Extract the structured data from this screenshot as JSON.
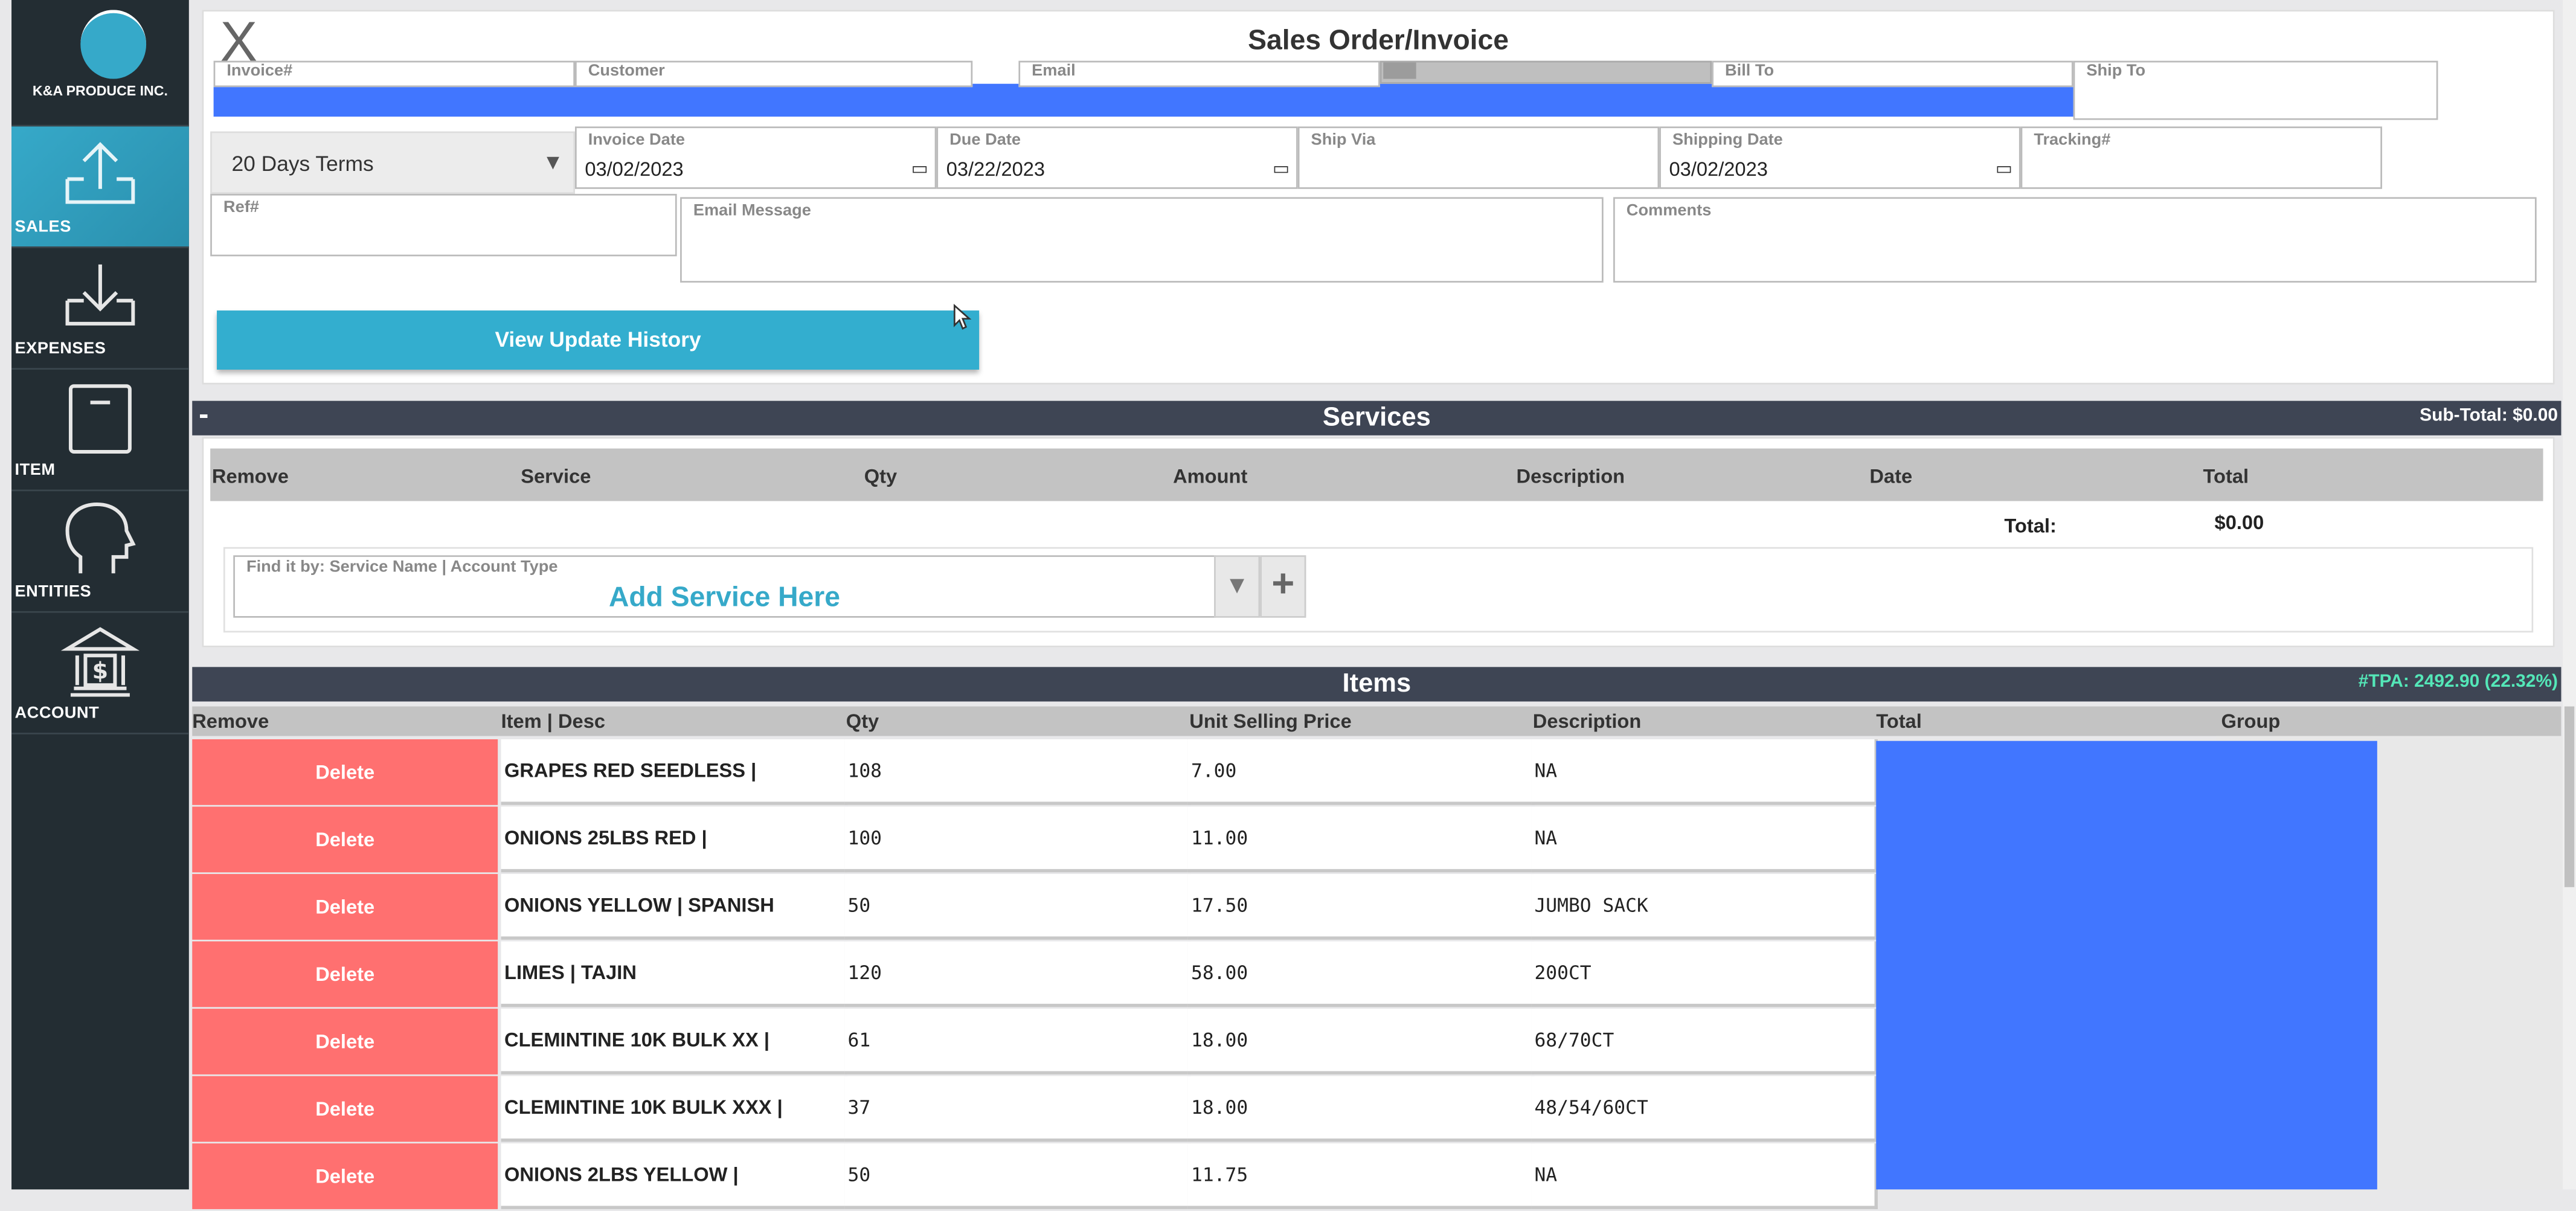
{
  "app": {
    "company": "K&A PRODUCE INC."
  },
  "sidebar": {
    "items": [
      {
        "label": "SALES",
        "icon": "upload-tray-icon",
        "active": true
      },
      {
        "label": "EXPENSES",
        "icon": "download-tray-icon",
        "active": false
      },
      {
        "label": "ITEM",
        "icon": "box-icon",
        "active": false
      },
      {
        "label": "ENTITIES",
        "icon": "head-profile-icon",
        "active": false
      },
      {
        "label": "ACCOUNT",
        "icon": "bank-icon",
        "active": false
      }
    ]
  },
  "form": {
    "title": "Sales Order/Invoice",
    "close_glyph": "X",
    "fields": {
      "invoice_no": {
        "label": "Invoice#",
        "value": ""
      },
      "customer": {
        "label": "Customer",
        "value": ""
      },
      "email": {
        "label": "Email",
        "value": ""
      },
      "bill_to": {
        "label": "Bill To",
        "value": ""
      },
      "ship_to": {
        "label": "Ship To",
        "value": ""
      },
      "terms": {
        "value": "20 Days Terms"
      },
      "invoice_date": {
        "label": "Invoice Date",
        "value": "03/02/2023"
      },
      "due_date": {
        "label": "Due Date",
        "value": "03/22/2023"
      },
      "ship_via": {
        "label": "Ship Via",
        "value": ""
      },
      "shipping_date": {
        "label": "Shipping Date",
        "value": "03/02/2023"
      },
      "tracking": {
        "label": "Tracking#",
        "value": ""
      },
      "ref": {
        "label": "Ref#",
        "value": ""
      },
      "email_message": {
        "label": "Email Message",
        "value": ""
      },
      "comments": {
        "label": "Comments",
        "value": ""
      }
    },
    "view_history_label": "View Update History"
  },
  "services": {
    "title": "Services",
    "minus": "-",
    "subtotal": "Sub-Total: $0.00",
    "columns": [
      "Remove",
      "Service",
      "Qty",
      "Amount",
      "Description",
      "Date",
      "Total"
    ],
    "total_label": "Total:",
    "total_value": "$0.00",
    "finder_label": "Find it by: Service Name | Account Type",
    "finder_placeholder": "Add Service Here"
  },
  "items": {
    "title": "Items",
    "tpa": "#TPA: 2492.90 (22.32%)",
    "columns": [
      "Remove",
      "Item | Desc",
      "Qty",
      "Unit Selling Price",
      "Description",
      "Total",
      "Group"
    ],
    "delete_label": "Delete",
    "rows": [
      {
        "item": "GRAPES RED SEEDLESS |",
        "qty": "108",
        "price": "7.00",
        "desc": "NA"
      },
      {
        "item": "ONIONS 25LBS RED |",
        "qty": "100",
        "price": "11.00",
        "desc": "NA"
      },
      {
        "item": "ONIONS YELLOW | SPANISH",
        "qty": "50",
        "price": "17.50",
        "desc": "JUMBO SACK"
      },
      {
        "item": "LIMES | TAJIN",
        "qty": "120",
        "price": "58.00",
        "desc": "200CT"
      },
      {
        "item": "CLEMINTINE 10K BULK XX |",
        "qty": "61",
        "price": "18.00",
        "desc": "68/70CT"
      },
      {
        "item": "CLEMINTINE 10K BULK XXX |",
        "qty": "37",
        "price": "18.00",
        "desc": "48/54/60CT"
      },
      {
        "item": "ONIONS 2LBS YELLOW |",
        "qty": "50",
        "price": "11.75",
        "desc": "NA"
      }
    ]
  }
}
